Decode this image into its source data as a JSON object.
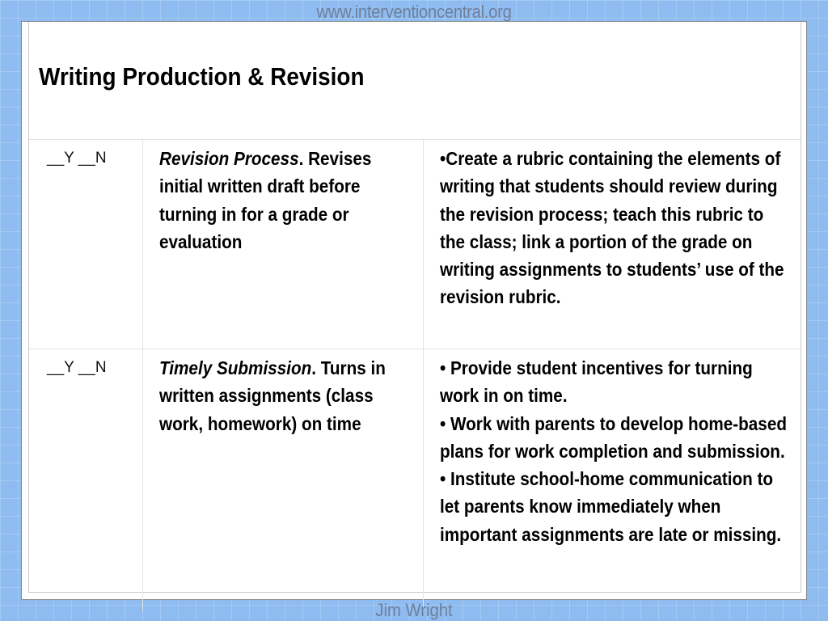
{
  "header": {
    "site_url": "www.interventioncentral.org"
  },
  "footer": {
    "author": "Jim Wright"
  },
  "slide": {
    "title": "Writing Production & Revision",
    "rows": [
      {
        "checkbox_text": "__Y __N",
        "skill_name": "Revision Process",
        "skill_rest": ". Revises initial written draft before turning in for a grade or evaluation",
        "strategies": [
          "•Create a rubric containing the elements of writing that students should review during the revision process; teach this rubric to the class; link a portion of the grade on writing assignments to students’ use of the revision rubric."
        ]
      },
      {
        "checkbox_text": "__Y __N",
        "skill_name": "Timely Submission",
        "skill_rest": ". Turns in written assignments (class work, homework) on time",
        "strategies": [
          "•   Provide student incentives for turning work in on time.",
          "•   Work with parents to develop home-based plans for work completion and submission.",
          "•   Institute school-home communication to let parents know immediately when important assignments are late or missing."
        ]
      }
    ]
  }
}
